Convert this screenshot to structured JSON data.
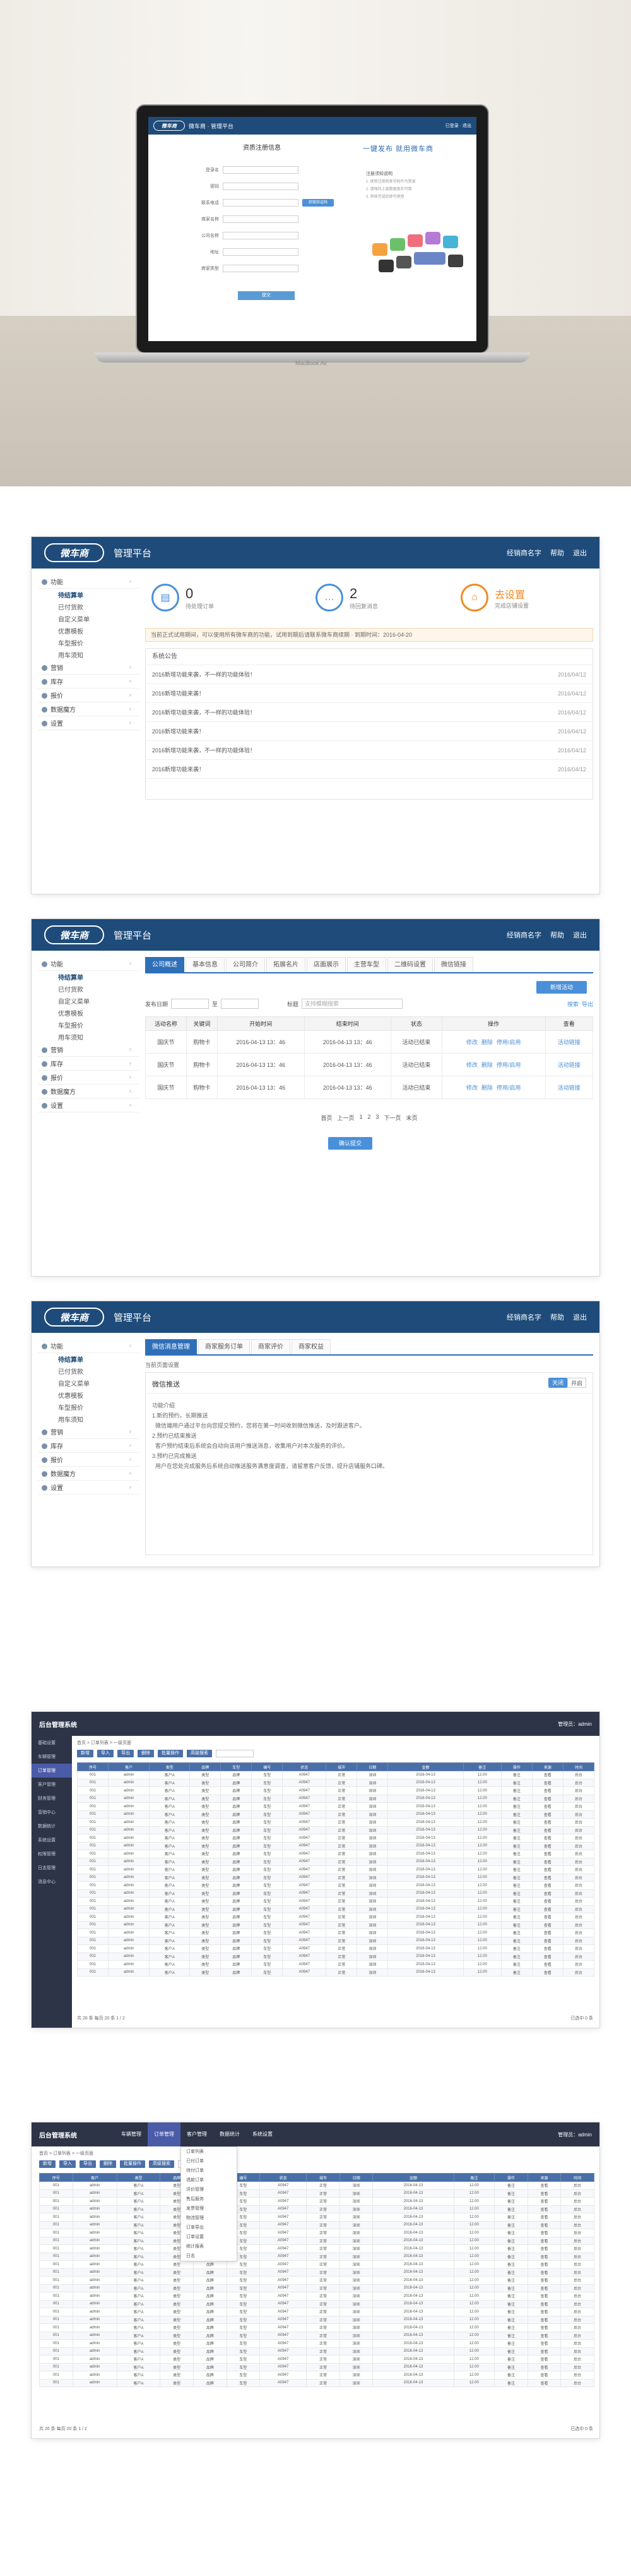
{
  "hero": {
    "brand": "微车商",
    "platform": "微车商 · 管理平台",
    "top_link": "已登录 · 退出",
    "register_title": "资质注册信息",
    "form_labels": [
      "登录名",
      "密码",
      "联系电话",
      "商家名称",
      "公司名称",
      "地址",
      "商家类型"
    ],
    "form_button": "提交",
    "verify_button": "获取验证码",
    "slogan": "一键发布  就用微车商",
    "notes_title": "注册须知说明",
    "notes": [
      "1. 使用注册商家号码作为登录",
      "2. 请保持上架数据真实可靠",
      "3. 审核完成后即可使用"
    ],
    "device_label": "MacBook Air"
  },
  "panel1": {
    "logo": "微车商",
    "title": "管理平台",
    "header_links": [
      "经销商名字",
      "帮助",
      "退出"
    ],
    "sidebar": [
      {
        "group": "功能",
        "items": [
          "待结算单",
          "已付货款",
          "自定义菜单",
          "优惠模板",
          "车型报价",
          "用车须知"
        ]
      },
      {
        "group": "营销",
        "items": []
      },
      {
        "group": "库存",
        "items": []
      },
      {
        "group": "报价",
        "items": []
      },
      {
        "group": "数据魔方",
        "items": []
      },
      {
        "group": "设置",
        "items": []
      }
    ],
    "stats": [
      {
        "num": "0",
        "label": "待处理订单"
      },
      {
        "num": "2",
        "label": "待回复消息"
      },
      {
        "num": "去设置",
        "label": "完成店铺设置"
      }
    ],
    "info": "当前正式试用期间，可以使用所有微车商的功能，试用到期后请联系微车商续期 · 到期时间：2016-04-20",
    "notice_title": "系统公告",
    "notices": [
      {
        "text": "2016新增功能来袭，不一样的功能体验！",
        "date": "2016/04/12"
      },
      {
        "text": "2016新增功能来袭！",
        "date": "2016/04/12"
      },
      {
        "text": "2016新增功能来袭，不一样的功能体验！",
        "date": "2016/04/12"
      },
      {
        "text": "2016新增功能来袭！",
        "date": "2016/04/12"
      },
      {
        "text": "2016新增功能来袭，不一样的功能体验！",
        "date": "2016/04/12"
      },
      {
        "text": "2016新增功能来袭！",
        "date": "2016/04/12"
      }
    ]
  },
  "panel2": {
    "tabs": [
      "公司概述",
      "基本信息",
      "公司简介",
      "拓展名片",
      "店面展示",
      "主营车型",
      "二维码设置",
      "微信链接"
    ],
    "add_button": "新增活动",
    "filter_labels": [
      "发布日期",
      "至",
      "标题",
      "支持模糊搜索",
      "搜索",
      "导出"
    ],
    "columns": [
      "活动名称",
      "关键词",
      "开始时间",
      "结束时间",
      "状态",
      "操作",
      "查看"
    ],
    "rows": [
      {
        "name": "国庆节",
        "kw": "购物卡",
        "start": "2016-04-13 13：46",
        "end": "2016-04-13 13：46",
        "status": "活动已结束",
        "ops": [
          "修改",
          "删除",
          "停用/启用"
        ],
        "view": "活动链接"
      },
      {
        "name": "国庆节",
        "kw": "购物卡",
        "start": "2016-04-13 13：46",
        "end": "2016-04-13 13：46",
        "status": "活动已结束",
        "ops": [
          "修改",
          "删除",
          "停用/启用"
        ],
        "view": "活动链接"
      },
      {
        "name": "国庆节",
        "kw": "购物卡",
        "start": "2016-04-13 13：46",
        "end": "2016-04-13 13：46",
        "status": "活动已结束",
        "ops": [
          "修改",
          "删除",
          "停用/启用"
        ],
        "view": "活动链接"
      }
    ],
    "pager": [
      "首页",
      "上一页",
      "1",
      "2",
      "3",
      "下一页",
      "末页"
    ],
    "bottom_button": "确认提交"
  },
  "panel3": {
    "tabs": [
      "微信消息管理",
      "商家服务订单",
      "商家评价",
      "商家权益"
    ],
    "breadcrumb": "当前页面设置",
    "section_title": "微信推送",
    "toggle": [
      "关闭",
      "开启"
    ],
    "text_lines": [
      "功能介绍",
      "1.新的预约，长期推送",
      "  微信端用户通过平台向您提交预约，您将在第一时间收到微信推送，及时跟进客户。",
      "2.预约已结束推送",
      "  客户预约结束后系统会自动向该用户推送消息，收集用户对本次服务的评价。",
      "3.预约已完成推送",
      "  用户在您处完成服务后系统自动推送服务满意度调查，请留意客户反馈，提升店铺服务口碑。"
    ]
  },
  "screen4": {
    "brand": "后台管理系统",
    "user": "管理员：admin",
    "breadcrumb": "首页 > 订单列表 > 一级页面",
    "side_items": [
      "基础设置",
      "车辆管理",
      "订单管理",
      "客户管理",
      "财务管理",
      "营销中心",
      "数据统计",
      "系统设置",
      "权限管理",
      "日志管理",
      "消息中心"
    ],
    "toolbar": [
      "新增",
      "导入",
      "导出",
      "删除",
      "批量操作",
      "高级搜索"
    ],
    "columns": [
      "序号",
      "客户",
      "类型",
      "品牌",
      "车型",
      "编号",
      "状态",
      "城市",
      "日期",
      "金额",
      "备注",
      "操作",
      "来源",
      "时间"
    ],
    "row_count": 26,
    "cell_text": [
      "001",
      "admin",
      "客户A",
      "类型",
      "品牌",
      "车型",
      "A0947",
      "正常",
      "深圳",
      "2016-04-13",
      "12.00",
      "备注",
      "查看",
      "后台",
      "2016-04-13 10:37"
    ],
    "pager": "共 26 条  每页 20 条  1 / 2",
    "footer_right": "已选中 0 条"
  },
  "screen5": {
    "brand": "后台管理系统",
    "user": "管理员：admin",
    "top_tabs": [
      "车辆管理",
      "订单管理",
      "客户管理",
      "数据统计",
      "系统设置"
    ],
    "breadcrumb": "首页 > 订单列表 > 一级页面",
    "dropdown": [
      "订单列表",
      "已付订单",
      "待付订单",
      "退款订单",
      "评价管理",
      "售后服务",
      "发票管理",
      "物流管理",
      "订单导出",
      "订单设置",
      "统计报表",
      "日志"
    ],
    "columns": [
      "序号",
      "客户",
      "类型",
      "品牌",
      "车型",
      "编号",
      "状态",
      "城市",
      "日期",
      "金额",
      "备注",
      "操作",
      "来源",
      "时间"
    ],
    "row_count": 26,
    "cell_text": [
      "001",
      "admin",
      "客户A",
      "类型",
      "品牌",
      "车型",
      "A0947",
      "正常",
      "深圳",
      "2016-04-13",
      "12.00",
      "备注",
      "查看",
      "后台",
      "2016-04-13 10:37"
    ],
    "pager": "共 26 条  每页 20 条  1 / 2",
    "footer_right": "已选中 0 条"
  }
}
